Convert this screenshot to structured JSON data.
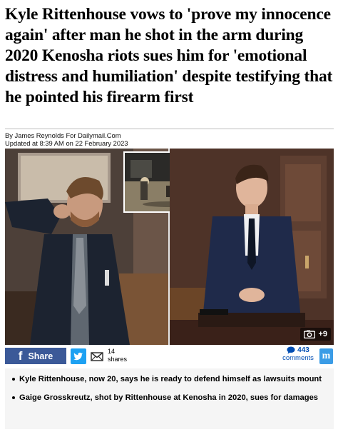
{
  "article": {
    "headline": "Kyle Rittenhouse vows to 'prove my innocence again' after man he shot in the arm during 2020 Kenosha riots sues him for 'emotional distress and humiliation' despite testifying that he pointed his firearm first",
    "byline": "By James Reynolds For Dailymail.Com",
    "updated": "Updated at 8:39 AM on 22 February 2023"
  },
  "photo": {
    "gallery_count": "+9",
    "camera_icon": "camera-icon"
  },
  "share": {
    "facebook_label": "Share",
    "share_count": "14",
    "share_label": "shares",
    "comment_count": "443",
    "comment_label": "comments",
    "brand_letter": "m",
    "colors": {
      "facebook": "#3b5998",
      "twitter": "#1da1f2",
      "comments": "#004db3",
      "brand": "#3b9ce6"
    }
  },
  "bullets": [
    "Kyle Rittenhouse, now 20, says he is ready to defend himself as lawsuits mount",
    "Gaige Grosskreutz, shot by Rittenhouse at Kenosha in 2020, sues for damages"
  ]
}
